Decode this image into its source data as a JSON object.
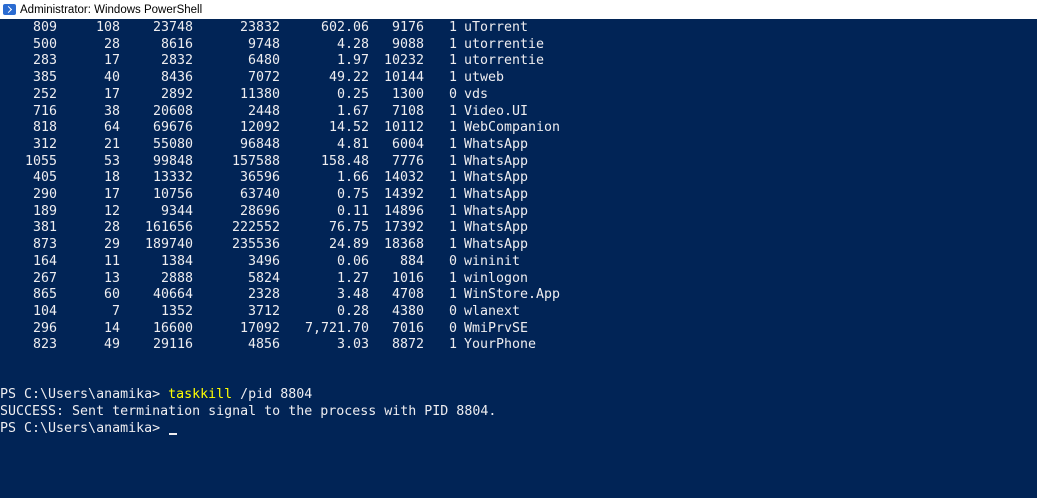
{
  "window": {
    "title": "Administrator: Windows PowerShell"
  },
  "processes": [
    {
      "handles": "809",
      "npm": "108",
      "pm": "23748",
      "ws": "23832",
      "cpu": "602.06",
      "id": "9176",
      "si": "1",
      "name": "uTorrent"
    },
    {
      "handles": "500",
      "npm": "28",
      "pm": "8616",
      "ws": "9748",
      "cpu": "4.28",
      "id": "9088",
      "si": "1",
      "name": "utorrentie"
    },
    {
      "handles": "283",
      "npm": "17",
      "pm": "2832",
      "ws": "6480",
      "cpu": "1.97",
      "id": "10232",
      "si": "1",
      "name": "utorrentie"
    },
    {
      "handles": "385",
      "npm": "40",
      "pm": "8436",
      "ws": "7072",
      "cpu": "49.22",
      "id": "10144",
      "si": "1",
      "name": "utweb"
    },
    {
      "handles": "252",
      "npm": "17",
      "pm": "2892",
      "ws": "11380",
      "cpu": "0.25",
      "id": "1300",
      "si": "0",
      "name": "vds"
    },
    {
      "handles": "716",
      "npm": "38",
      "pm": "20608",
      "ws": "2448",
      "cpu": "1.67",
      "id": "7108",
      "si": "1",
      "name": "Video.UI"
    },
    {
      "handles": "818",
      "npm": "64",
      "pm": "69676",
      "ws": "12092",
      "cpu": "14.52",
      "id": "10112",
      "si": "1",
      "name": "WebCompanion"
    },
    {
      "handles": "312",
      "npm": "21",
      "pm": "55080",
      "ws": "96848",
      "cpu": "4.81",
      "id": "6004",
      "si": "1",
      "name": "WhatsApp"
    },
    {
      "handles": "1055",
      "npm": "53",
      "pm": "99848",
      "ws": "157588",
      "cpu": "158.48",
      "id": "7776",
      "si": "1",
      "name": "WhatsApp"
    },
    {
      "handles": "405",
      "npm": "18",
      "pm": "13332",
      "ws": "36596",
      "cpu": "1.66",
      "id": "14032",
      "si": "1",
      "name": "WhatsApp"
    },
    {
      "handles": "290",
      "npm": "17",
      "pm": "10756",
      "ws": "63740",
      "cpu": "0.75",
      "id": "14392",
      "si": "1",
      "name": "WhatsApp"
    },
    {
      "handles": "189",
      "npm": "12",
      "pm": "9344",
      "ws": "28696",
      "cpu": "0.11",
      "id": "14896",
      "si": "1",
      "name": "WhatsApp"
    },
    {
      "handles": "381",
      "npm": "28",
      "pm": "161656",
      "ws": "222552",
      "cpu": "76.75",
      "id": "17392",
      "si": "1",
      "name": "WhatsApp"
    },
    {
      "handles": "873",
      "npm": "29",
      "pm": "189740",
      "ws": "235536",
      "cpu": "24.89",
      "id": "18368",
      "si": "1",
      "name": "WhatsApp"
    },
    {
      "handles": "164",
      "npm": "11",
      "pm": "1384",
      "ws": "3496",
      "cpu": "0.06",
      "id": "884",
      "si": "0",
      "name": "wininit"
    },
    {
      "handles": "267",
      "npm": "13",
      "pm": "2888",
      "ws": "5824",
      "cpu": "1.27",
      "id": "1016",
      "si": "1",
      "name": "winlogon"
    },
    {
      "handles": "865",
      "npm": "60",
      "pm": "40664",
      "ws": "2328",
      "cpu": "3.48",
      "id": "4708",
      "si": "1",
      "name": "WinStore.App"
    },
    {
      "handles": "104",
      "npm": "7",
      "pm": "1352",
      "ws": "3712",
      "cpu": "0.28",
      "id": "4380",
      "si": "0",
      "name": "wlanext"
    },
    {
      "handles": "296",
      "npm": "14",
      "pm": "16600",
      "ws": "17092",
      "cpu": "7,721.70",
      "id": "7016",
      "si": "0",
      "name": "WmiPrvSE"
    },
    {
      "handles": "823",
      "npm": "49",
      "pm": "29116",
      "ws": "4856",
      "cpu": "3.03",
      "id": "8872",
      "si": "1",
      "name": "YourPhone"
    }
  ],
  "session": {
    "prompt": "PS C:\\Users\\anamika> ",
    "command": "taskkill",
    "args": " /pid 8804",
    "output": "SUCCESS: Sent termination signal to the process with PID 8804.",
    "prompt2": "PS C:\\Users\\anamika> "
  },
  "colors": {
    "background": "#012456",
    "foreground": "#eeedf0",
    "command": "#ffff00"
  }
}
